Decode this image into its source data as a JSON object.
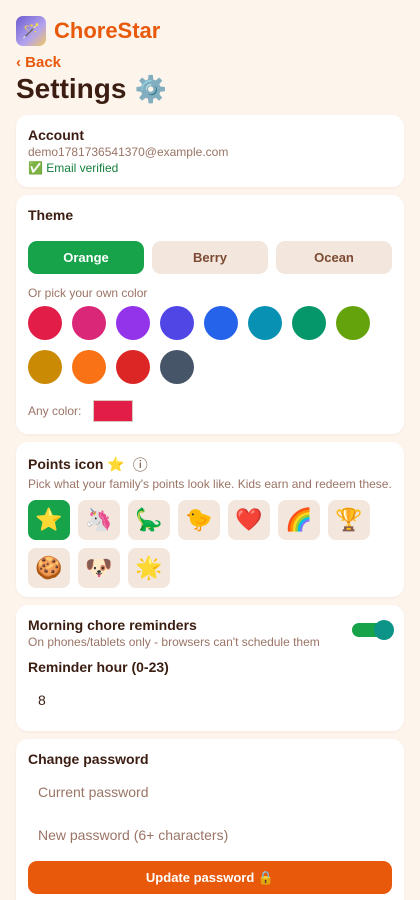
{
  "app": {
    "name": "ChoreStar",
    "logo_icon": "🪄"
  },
  "nav": {
    "back_label": "‹ Back"
  },
  "page": {
    "title": "Settings",
    "title_icon": "⚙️"
  },
  "account": {
    "title": "Account",
    "email": "demo1781736541370@example.com",
    "status": "✅ Email verified"
  },
  "theme": {
    "title": "Theme",
    "options": [
      "Orange",
      "Berry",
      "Ocean"
    ],
    "selected": "Orange",
    "custom_label": "Or pick your own color",
    "swatches": [
      "#e11d48",
      "#db2777",
      "#9333ea",
      "#4f46e5",
      "#2563eb",
      "#0891b2",
      "#059669",
      "#65a30d",
      "#ca8a04",
      "#f97316",
      "#dc2626",
      "#475569"
    ],
    "any_color_label": "Any color:",
    "any_color_value": "#e11d48"
  },
  "points": {
    "title": "Points icon ⭐",
    "info_icon": "ⓘ",
    "description": "Pick what your family's points look like. Kids earn and redeem these.",
    "icons": [
      "⭐",
      "🦄",
      "🦕",
      "🐤",
      "❤️",
      "🌈",
      "🏆",
      "🍪",
      "🐶",
      "🌟"
    ],
    "selected_index": 0
  },
  "reminders": {
    "title": "Morning chore reminders",
    "subtitle": "On phones/tablets only - browsers can't schedule them",
    "enabled": true,
    "hour_label": "Reminder hour (0-23)",
    "hour_value": "8"
  },
  "password": {
    "title": "Change password",
    "current_placeholder": "Current password",
    "new_placeholder": "New password (6+ characters)",
    "button_label": "Update password 🔒"
  },
  "colors": {
    "accent": "#e8590c",
    "success": "#16a34a",
    "background": "#fdf4ec"
  }
}
